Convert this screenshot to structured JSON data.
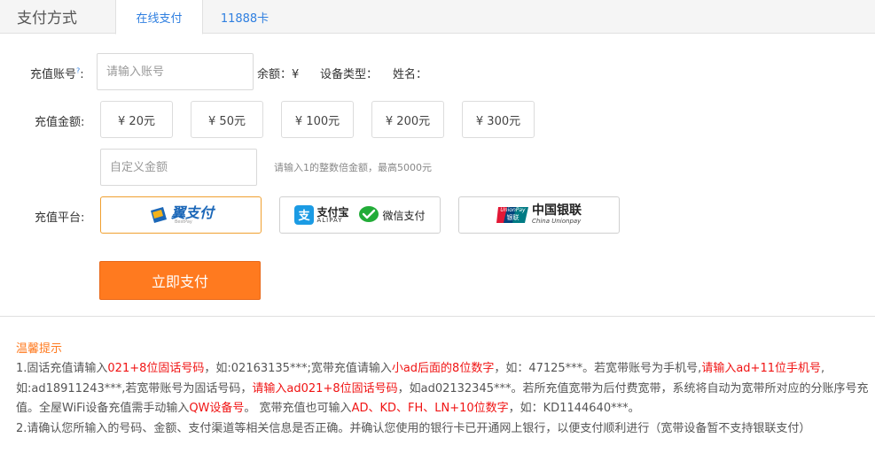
{
  "header": {
    "title": "支付方式",
    "tabs": [
      {
        "label": "在线支付",
        "active": true
      },
      {
        "label": "11888卡",
        "active": false
      }
    ]
  },
  "account": {
    "label": "充值账号",
    "help": "?",
    "colon": ":",
    "placeholder": "请输入账号",
    "balance_label": "余额：",
    "balance_value": "¥",
    "device_label": "设备类型：",
    "name_label": "姓名："
  },
  "amount": {
    "label": "充值金额:",
    "options": [
      "¥ 20元",
      "¥ 50元",
      "¥ 100元",
      "¥ 200元",
      "¥ 300元"
    ],
    "custom_placeholder": "自定义金额",
    "hint": "请输入1的整数倍金额，最高5000元"
  },
  "platform": {
    "label": "充值平台:",
    "options": [
      {
        "name": "翼支付",
        "sub": "BestPay",
        "selected": true
      },
      {
        "name": "支付宝",
        "sub": "ALIPAY",
        "extra": "微信支付",
        "selected": false
      },
      {
        "name": "中国银联",
        "sub": "China Unionpay",
        "badge": "UnionPay",
        "badge2": "银联",
        "selected": false
      }
    ]
  },
  "pay_button": "立即支付",
  "tips": {
    "title": "温馨提示",
    "p1": {
      "s1": "1.固话充值请输入",
      "r1": "021+8位固话号码",
      "s2": "，如:02163135***;宽带充值请输入",
      "r2": "小ad后面的8位数字",
      "s3": "，如：47125***。若宽带账号为手机号,",
      "r3": "请输入ad+11位手机号",
      "s4": ",如:ad18911243***,若宽带账号为固话号码，",
      "r4": "请输入ad021+8位固话号码",
      "s5": "，如ad02132345***。若所充值宽带为后付费宽带，系统将自动为宽带所对应的分账序号充值。全屋WiFi设备充值需手动输入",
      "r5": "QW设备号",
      "s6": "。 宽带充值也可输入",
      "r6": "AD、KD、FH、LN+10位数字",
      "s7": "，如：KD1144640***。"
    },
    "p2": "2.请确认您所输入的号码、金额、支付渠道等相关信息是否正确。并确认您使用的银行卡已开通网上银行，以便支付顺利进行（宽带设备暂不支持银联支付）"
  },
  "colors": {
    "accent": "#ff7a1f",
    "tab_blue": "#2f7fe0",
    "highlight_red": "#f01414",
    "selected_border": "#f0a030"
  }
}
